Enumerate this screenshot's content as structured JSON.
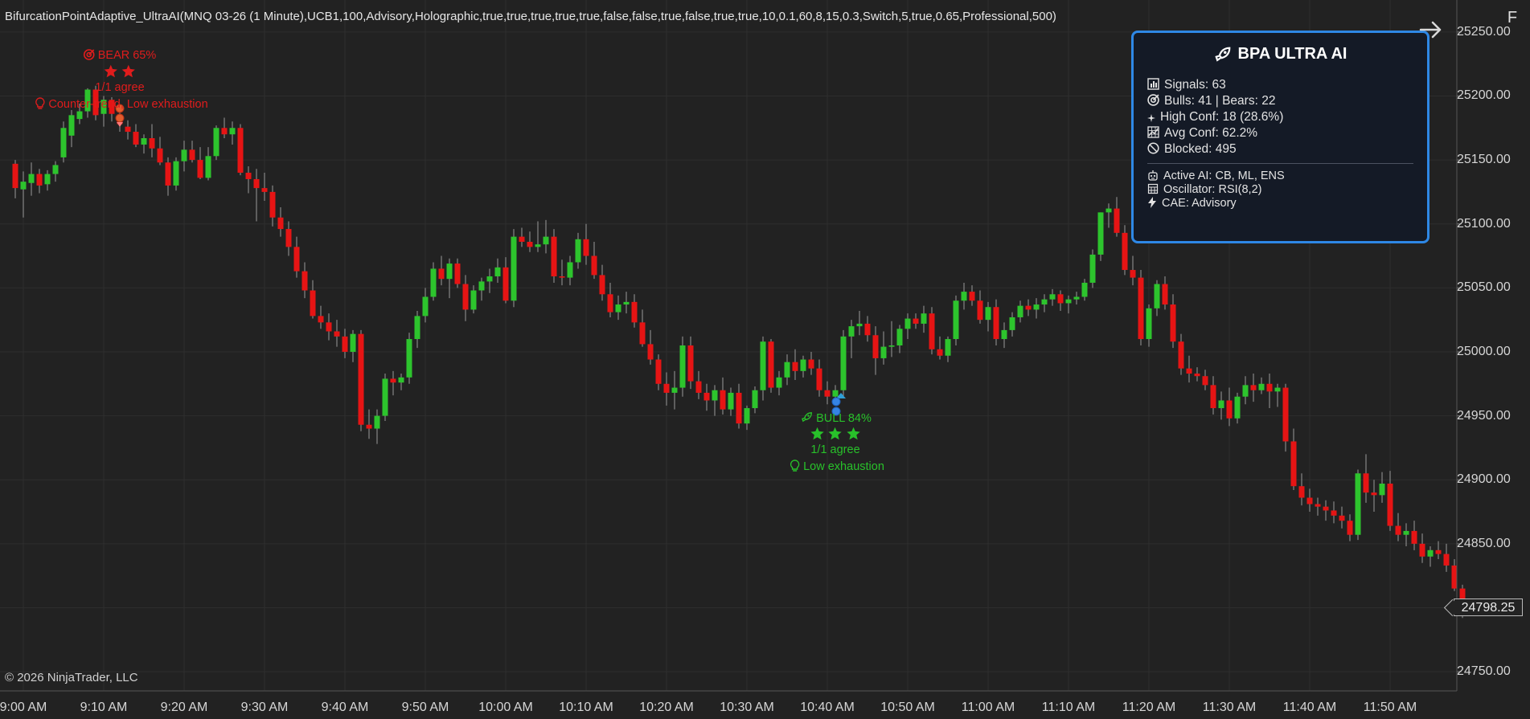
{
  "window": {
    "title": "BifurcationPointAdaptive_UltraAI(MNQ 03-26 (1 Minute),UCB1,100,Advisory,Holographic,true,true,true,true,true,false,false,true,false,true,true,10,0.1,60,8,15,0.3,Switch,5,true,0.65,Professional,500)",
    "copyright": "© 2026 NinjaTrader, LLC",
    "corner_button": "F"
  },
  "colors": {
    "background": "#222222",
    "grid": "#2e2e2e",
    "bull_candle": "#2dc42d",
    "bear_candle": "#e61414",
    "panel_border": "#2e88e6",
    "panel_bg": "#141a26"
  },
  "axis": {
    "price_labels": [
      "25250.00",
      "25200.00",
      "25150.00",
      "25100.00",
      "25050.00",
      "25000.00",
      "24950.00",
      "24900.00",
      "24850.00",
      "24800.00",
      "24750.00"
    ],
    "price_values": [
      25250,
      25200,
      25150,
      25100,
      25050,
      25000,
      24950,
      24900,
      24850,
      24800,
      24750
    ],
    "time_labels": [
      "9:00 AM",
      "9:10 AM",
      "9:20 AM",
      "9:30 AM",
      "9:40 AM",
      "9:50 AM",
      "10:00 AM",
      "10:10 AM",
      "10:20 AM",
      "10:30 AM",
      "10:40 AM",
      "10:50 AM",
      "11:00 AM",
      "11:10 AM",
      "11:20 AM",
      "11:30 AM",
      "11:40 AM",
      "11:50 AM"
    ],
    "current_price": "24798.25"
  },
  "panel": {
    "title": "BPA ULTRA AI",
    "signals": "Signals: 63",
    "bulls_bears": "Bulls: 41 | Bears: 22",
    "high_conf": "High Conf: 18 (28.6%)",
    "avg_conf": "Avg Conf: 62.2%",
    "blocked": "Blocked: 495",
    "active_ai": "Active AI: CB, ML, ENS",
    "oscillator": "Oscillator: RSI(8,2)",
    "cae": "CAE: Advisory"
  },
  "signals": {
    "bear": {
      "label": "BEAR 65%",
      "stars": 2,
      "agree": "1/1 agree",
      "note": "Counter-trend, Low exhaustion"
    },
    "bull": {
      "label": "BULL 84%",
      "stars": 3,
      "agree": "1/1 agree",
      "note": "Low exhaustion"
    }
  },
  "chart_data": {
    "type": "candlestick",
    "symbol": "MNQ 03-26 (1 Minute)",
    "ylim": [
      24735,
      25275
    ],
    "x_start": "8:59 AM",
    "interval_minutes": 1,
    "ohlc": [
      [
        25147,
        25150,
        25120,
        25128
      ],
      [
        25127,
        25141,
        25105,
        25133
      ],
      [
        25132,
        25148,
        25122,
        25139
      ],
      [
        25139,
        25143,
        25124,
        25130
      ],
      [
        25131,
        25142,
        25126,
        25139
      ],
      [
        25139,
        25149,
        25133,
        25146
      ],
      [
        25152,
        25180,
        25148,
        25175
      ],
      [
        25169,
        25189,
        25160,
        25185
      ],
      [
        25182,
        25194,
        25178,
        25188
      ],
      [
        25188,
        25206,
        25183,
        25205
      ],
      [
        25205,
        25208,
        25181,
        25185
      ],
      [
        25186,
        25200,
        25176,
        25197
      ],
      [
        25197,
        25199,
        25180,
        25186
      ],
      [
        25183,
        25190,
        25172,
        25178
      ],
      [
        25176,
        25181,
        25166,
        25172
      ],
      [
        25172,
        25178,
        25160,
        25162
      ],
      [
        25162,
        25170,
        25155,
        25167
      ],
      [
        25167,
        25178,
        25152,
        25159
      ],
      [
        25159,
        25168,
        25146,
        25148
      ],
      [
        25148,
        25152,
        25122,
        25130
      ],
      [
        25130,
        25152,
        25126,
        25149
      ],
      [
        25149,
        25165,
        25141,
        25158
      ],
      [
        25158,
        25165,
        25148,
        25150
      ],
      [
        25150,
        25160,
        25135,
        25136
      ],
      [
        25136,
        25160,
        25134,
        25153
      ],
      [
        25153,
        25177,
        25150,
        25175
      ],
      [
        25175,
        25183,
        25167,
        25170
      ],
      [
        25170,
        25180,
        25162,
        25175
      ],
      [
        25175,
        25178,
        25138,
        25140
      ],
      [
        25140,
        25145,
        25124,
        25135
      ],
      [
        25135,
        25143,
        25102,
        25128
      ],
      [
        25128,
        25140,
        25118,
        25125
      ],
      [
        25125,
        25130,
        25098,
        25105
      ],
      [
        25105,
        25113,
        25090,
        25096
      ],
      [
        25096,
        25102,
        25075,
        25082
      ],
      [
        25082,
        25090,
        25058,
        25063
      ],
      [
        25063,
        25070,
        25042,
        25048
      ],
      [
        25048,
        25056,
        25026,
        25028
      ],
      [
        25028,
        25036,
        25018,
        25023
      ],
      [
        25023,
        25030,
        25009,
        25016
      ],
      [
        25016,
        25025,
        25004,
        25012
      ],
      [
        25012,
        25018,
        24995,
        25000
      ],
      [
        25000,
        25017,
        24992,
        25014
      ],
      [
        25014,
        25017,
        24938,
        24943
      ],
      [
        24943,
        24955,
        24932,
        24940
      ],
      [
        24940,
        24955,
        24928,
        24950
      ],
      [
        24950,
        24983,
        24946,
        24979
      ],
      [
        24979,
        24985,
        24966,
        24976
      ],
      [
        24976,
        24983,
        24970,
        24980
      ],
      [
        24980,
        25015,
        24975,
        25010
      ],
      [
        25010,
        25032,
        25003,
        25028
      ],
      [
        25028,
        25050,
        25023,
        25043
      ],
      [
        25043,
        25070,
        25040,
        25065
      ],
      [
        25065,
        25075,
        25052,
        25057
      ],
      [
        25057,
        25073,
        25042,
        25069
      ],
      [
        25069,
        25073,
        25050,
        25053
      ],
      [
        25053,
        25060,
        25024,
        25033
      ],
      [
        25033,
        25052,
        25030,
        25048
      ],
      [
        25048,
        25058,
        25040,
        25055
      ],
      [
        25055,
        25065,
        25046,
        25059
      ],
      [
        25059,
        25073,
        25054,
        25066
      ],
      [
        25066,
        25074,
        25038,
        25040
      ],
      [
        25040,
        25096,
        25035,
        25090
      ],
      [
        25090,
        25097,
        25082,
        25086
      ],
      [
        25086,
        25094,
        25078,
        25082
      ],
      [
        25082,
        25102,
        25078,
        25084
      ],
      [
        25084,
        25103,
        25077,
        25090
      ],
      [
        25090,
        25096,
        25054,
        25059
      ],
      [
        25059,
        25072,
        25052,
        25058
      ],
      [
        25058,
        25075,
        25052,
        25070
      ],
      [
        25070,
        25093,
        25065,
        25088
      ],
      [
        25088,
        25100,
        25068,
        25075
      ],
      [
        25075,
        25086,
        25057,
        25060
      ],
      [
        25060,
        25068,
        25040,
        25045
      ],
      [
        25045,
        25054,
        25027,
        25031
      ],
      [
        25031,
        25044,
        25025,
        25037
      ],
      [
        25037,
        25047,
        25030,
        25039
      ],
      [
        25039,
        25045,
        25019,
        25023
      ],
      [
        25023,
        25033,
        25004,
        25006
      ],
      [
        25006,
        25017,
        24990,
        24994
      ],
      [
        24994,
        24998,
        24970,
        24975
      ],
      [
        24975,
        24984,
        24958,
        24968
      ],
      [
        24968,
        24985,
        24955,
        24972
      ],
      [
        24972,
        25012,
        24965,
        25005
      ],
      [
        25005,
        25012,
        24971,
        24977
      ],
      [
        24977,
        24985,
        24963,
        24968
      ],
      [
        24968,
        24975,
        24954,
        24962
      ],
      [
        24962,
        24974,
        24950,
        24970
      ],
      [
        24970,
        24980,
        24951,
        24955
      ],
      [
        24955,
        24972,
        24950,
        24968
      ],
      [
        24968,
        24975,
        24940,
        24944
      ],
      [
        24944,
        24958,
        24939,
        24956
      ],
      [
        24956,
        24973,
        24952,
        24970
      ],
      [
        24970,
        25012,
        24962,
        25008
      ],
      [
        25008,
        25010,
        24968,
        24972
      ],
      [
        24972,
        24985,
        24966,
        24980
      ],
      [
        24980,
        24998,
        24974,
        24992
      ],
      [
        24992,
        25002,
        24978,
        24985
      ],
      [
        24985,
        24997,
        24980,
        24994
      ],
      [
        24994,
        25000,
        24982,
        24987
      ],
      [
        24987,
        24994,
        24965,
        24970
      ],
      [
        24970,
        24977,
        24959,
        24965
      ],
      [
        24965,
        24974,
        24958,
        24970
      ],
      [
        24970,
        25017,
        24965,
        25012
      ],
      [
        25012,
        25025,
        24995,
        25020
      ],
      [
        25020,
        25032,
        25013,
        25022
      ],
      [
        25022,
        25028,
        25008,
        25013
      ],
      [
        25013,
        25020,
        24982,
        24995
      ],
      [
        24995,
        25016,
        24990,
        25004
      ],
      [
        25004,
        25024,
        24996,
        25005
      ],
      [
        25005,
        25021,
        24999,
        25018
      ],
      [
        25018,
        25030,
        25010,
        25026
      ],
      [
        25026,
        25030,
        25018,
        25022
      ],
      [
        25022,
        25036,
        25015,
        25030
      ],
      [
        25030,
        25035,
        24998,
        25002
      ],
      [
        25002,
        25012,
        24994,
        24997
      ],
      [
        24997,
        25012,
        24992,
        25010
      ],
      [
        25010,
        25044,
        25005,
        25040
      ],
      [
        25040,
        25054,
        25033,
        25047
      ],
      [
        25047,
        25052,
        25036,
        25040
      ],
      [
        25040,
        25048,
        25022,
        25025
      ],
      [
        25025,
        25039,
        25016,
        25035
      ],
      [
        25035,
        25041,
        25005,
        25010
      ],
      [
        25010,
        25023,
        25003,
        25017
      ],
      [
        25017,
        25031,
        25012,
        25027
      ],
      [
        25027,
        25040,
        25023,
        25036
      ],
      [
        25036,
        25041,
        25028,
        25033
      ],
      [
        25033,
        25042,
        25026,
        25037
      ],
      [
        25037,
        25045,
        25031,
        25041
      ],
      [
        25041,
        25049,
        25036,
        25045
      ],
      [
        25045,
        25048,
        25032,
        25038
      ],
      [
        25038,
        25044,
        25030,
        25041
      ],
      [
        25041,
        25047,
        25037,
        25043
      ],
      [
        25043,
        25057,
        25040,
        25054
      ],
      [
        25054,
        25080,
        25050,
        25076
      ],
      [
        25076,
        25109,
        25071,
        25109
      ],
      [
        25109,
        25116,
        25097,
        25112
      ],
      [
        25112,
        25121,
        25090,
        25093
      ],
      [
        25093,
        25099,
        25060,
        25064
      ],
      [
        25064,
        25075,
        25052,
        25058
      ],
      [
        25058,
        25064,
        25005,
        25010
      ],
      [
        25010,
        25037,
        25004,
        25034
      ],
      [
        25034,
        25056,
        25028,
        25053
      ],
      [
        25053,
        25059,
        25033,
        25037
      ],
      [
        25037,
        25045,
        25003,
        25008
      ],
      [
        25008,
        25014,
        24982,
        24987
      ],
      [
        24987,
        24997,
        24976,
        24983
      ],
      [
        24983,
        24988,
        24977,
        24981
      ],
      [
        24981,
        24986,
        24970,
        24974
      ],
      [
        24974,
        24981,
        24951,
        24956
      ],
      [
        24956,
        24969,
        24947,
        24962
      ],
      [
        24962,
        24972,
        24942,
        24948
      ],
      [
        24948,
        24968,
        24944,
        24965
      ],
      [
        24965,
        24981,
        24959,
        24974
      ],
      [
        24974,
        24983,
        24961,
        24970
      ],
      [
        24970,
        24980,
        24967,
        24975
      ],
      [
        24975,
        24983,
        24956,
        24969
      ],
      [
        24969,
        24975,
        24957,
        24972
      ],
      [
        24972,
        24975,
        24922,
        24930
      ],
      [
        24930,
        24940,
        24892,
        24895
      ],
      [
        24895,
        24905,
        24880,
        24886
      ],
      [
        24886,
        24893,
        24875,
        24881
      ],
      [
        24881,
        24886,
        24872,
        24879
      ],
      [
        24879,
        24884,
        24868,
        24876
      ],
      [
        24876,
        24883,
        24866,
        24872
      ],
      [
        24872,
        24879,
        24862,
        24868
      ],
      [
        24868,
        24873,
        24852,
        24857
      ],
      [
        24857,
        24908,
        24853,
        24905
      ],
      [
        24905,
        24920,
        24882,
        24890
      ],
      [
        24890,
        24900,
        24875,
        24888
      ],
      [
        24888,
        24906,
        24882,
        24897
      ],
      [
        24897,
        24907,
        24860,
        24864
      ],
      [
        24864,
        24874,
        24852,
        24857
      ],
      [
        24857,
        24866,
        24848,
        24860
      ],
      [
        24860,
        24868,
        24845,
        24850
      ],
      [
        24850,
        24858,
        24835,
        24840
      ],
      [
        24840,
        24848,
        24832,
        24845
      ],
      [
        24845,
        24852,
        24838,
        24842
      ],
      [
        24842,
        24850,
        24828,
        24833
      ],
      [
        24833,
        24838,
        24813,
        24815
      ],
      [
        24815,
        24818,
        24792,
        24798
      ]
    ]
  }
}
